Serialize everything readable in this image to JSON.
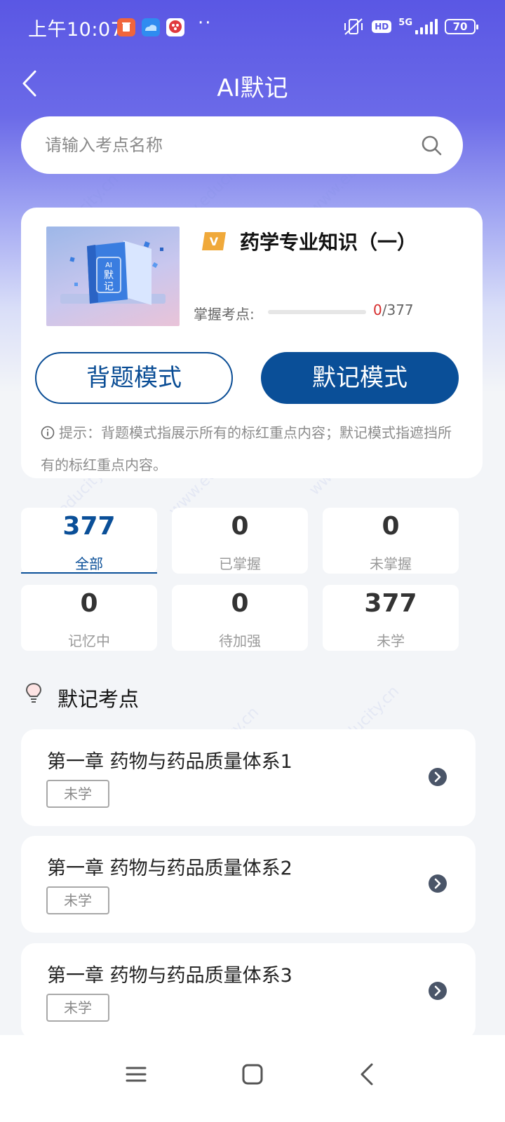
{
  "status_bar": {
    "time": "上午10:07",
    "battery": "70",
    "network": "5G"
  },
  "header": {
    "title": "AI默记",
    "back_icon": "chevron-left-icon"
  },
  "search": {
    "placeholder": "请输入考点名称",
    "value": "",
    "icon": "search-icon"
  },
  "course": {
    "cover_text": "AI默记",
    "badge": "V",
    "title": "药学专业知识（一）",
    "progress_label": "掌握考点:",
    "mastered": "0",
    "total": "/377",
    "progress_fraction": 0,
    "buttons": {
      "recite": "背题模式",
      "memorize": "默记模式"
    },
    "tip": "提示：背题模式指展示所有的标红重点内容；默记模式指遮挡所有的标红重点内容。"
  },
  "stats": [
    {
      "num": "377",
      "label": "全部",
      "active": true
    },
    {
      "num": "0",
      "label": "已掌握"
    },
    {
      "num": "0",
      "label": "未掌握"
    },
    {
      "num": "0",
      "label": "记忆中"
    },
    {
      "num": "0",
      "label": "待加强"
    },
    {
      "num": "377",
      "label": "未学"
    }
  ],
  "section": {
    "title": "默记考点",
    "icon": "lightbulb-icon"
  },
  "items": [
    {
      "title": "第一章 药物与药品质量体系1",
      "status": "未学"
    },
    {
      "title": "第一章 药物与药品质量体系2",
      "status": "未学"
    },
    {
      "title": "第一章 药物与药品质量体系3",
      "status": "未学"
    }
  ],
  "nav": [
    "menu-icon",
    "home-square-icon",
    "back-triangle-icon"
  ],
  "colors": {
    "primary": "#0a4f98",
    "header_bg": "#5a57e4",
    "progress": "#d62c2c",
    "background": "#f3f5f8"
  }
}
